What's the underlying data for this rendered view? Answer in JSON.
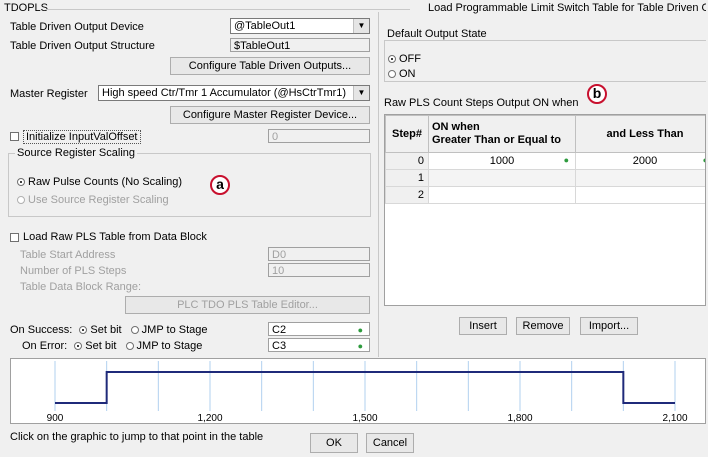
{
  "window": {
    "title": "TDOPLS",
    "subtitle": "Load Programmable Limit Switch Table for Table Driven Output"
  },
  "device": {
    "label": "Table Driven Output Device",
    "value": "@TableOut1"
  },
  "structure": {
    "label": "Table Driven Output Structure",
    "value": "$TableOut1"
  },
  "configure_tdo_btn": "Configure Table Driven Outputs...",
  "master": {
    "label": "Master Register",
    "value": "High speed Ctr/Tmr 1 Accumulator (@HsCtrTmr1)"
  },
  "configure_master_btn": "Configure Master Register Device...",
  "init_offset": {
    "label": "Initialize InputValOffset",
    "value": "0"
  },
  "source_scaling": {
    "title": "Source Register Scaling",
    "raw": "Raw Pulse Counts (No Scaling)",
    "use": "Use Source Register Scaling"
  },
  "annotations": {
    "a": "a",
    "b": "b"
  },
  "load_block": {
    "label": "Load Raw PLS Table from Data Block",
    "start_label": "Table Start Address",
    "start_value": "D0",
    "steps_label": "Number of PLS Steps",
    "steps_value": "10",
    "range_label": "Table Data Block Range:",
    "editor_btn": "PLC TDO PLS Table Editor..."
  },
  "on_success": {
    "label": "On Success:",
    "set_bit": "Set bit",
    "jmp": "JMP to Stage",
    "value": "C2"
  },
  "on_error": {
    "label": "On Error:",
    "set_bit": "Set bit",
    "jmp": "JMP to Stage",
    "value": "C3"
  },
  "default_output": {
    "title": "Default Output State",
    "off": "OFF",
    "on": "ON"
  },
  "pls_header": {
    "text": "Raw PLS Count Steps Output",
    "on": "ON",
    "when": "when"
  },
  "table": {
    "col_step": "Step#",
    "col_on": "ON when\nGreater Than or Equal to",
    "col_less": "and Less Than",
    "rows": [
      {
        "step": "0",
        "ge": "1000",
        "lt": "2000"
      },
      {
        "step": "1",
        "ge": "",
        "lt": ""
      },
      {
        "step": "2",
        "ge": "",
        "lt": ""
      }
    ]
  },
  "table_buttons": {
    "insert": "Insert",
    "remove": "Remove",
    "import": "Import..."
  },
  "graph": {
    "ticks": [
      {
        "label": "900",
        "value": 900
      },
      {
        "label": "1,200",
        "value": 1200
      },
      {
        "label": "1,500",
        "value": 1500
      },
      {
        "label": "1,800",
        "value": 1800
      },
      {
        "label": "2,100",
        "value": 2100
      }
    ],
    "x_range": [
      900,
      2100
    ],
    "on_start": 1000,
    "on_end": 2000,
    "hint": "Click on the graphic to jump to that point in the table"
  },
  "footer": {
    "ok": "OK",
    "cancel": "Cancel"
  },
  "colors": {
    "accent": "#c8102e",
    "signal": "#1f2a7a",
    "grid": "#7fb2e5",
    "ok_dot": "#2e9b3e"
  }
}
